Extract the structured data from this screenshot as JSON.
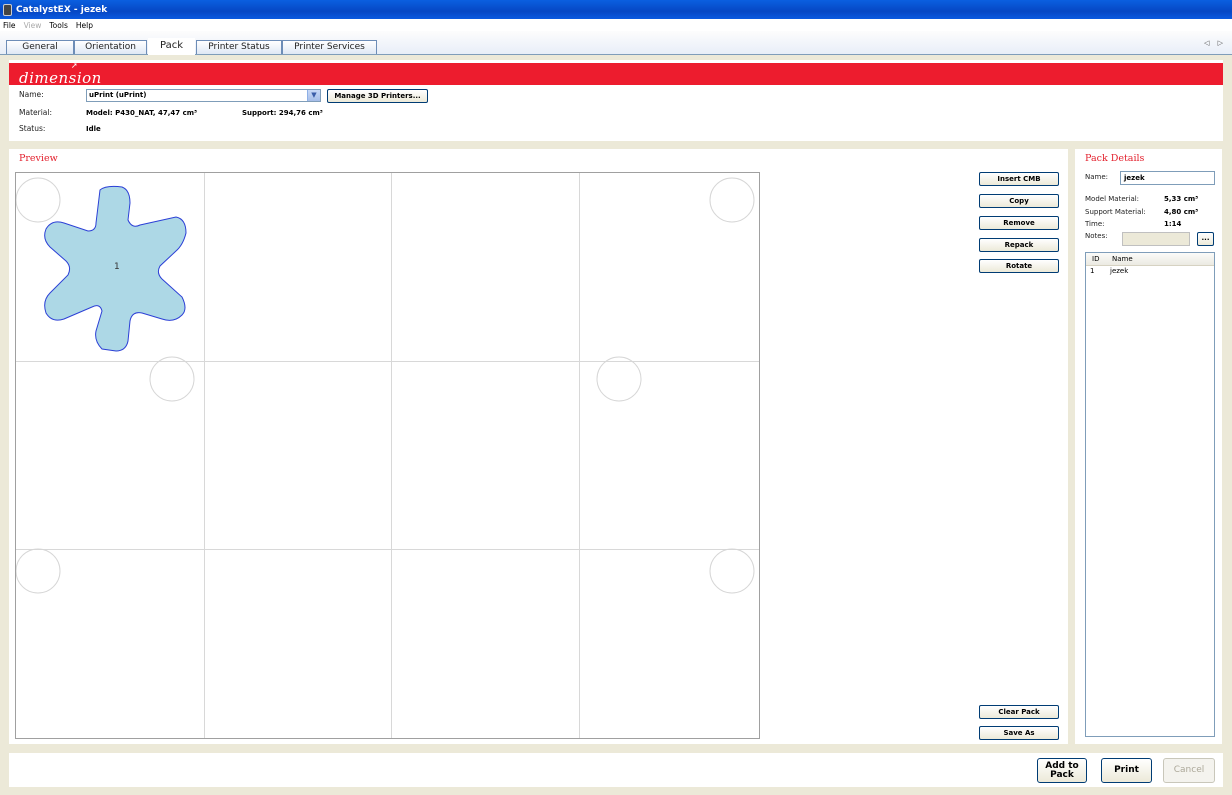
{
  "window": {
    "title": "CatalystEX - jezek"
  },
  "menu": {
    "items": [
      {
        "label": "File",
        "enabled": true
      },
      {
        "label": "View",
        "enabled": false
      },
      {
        "label": "Tools",
        "enabled": true
      },
      {
        "label": "Help",
        "enabled": true
      }
    ]
  },
  "tabs": [
    {
      "label": "General"
    },
    {
      "label": "Orientation"
    },
    {
      "label": "Pack",
      "active": true
    },
    {
      "label": "Printer Status"
    },
    {
      "label": "Printer Services"
    }
  ],
  "tab_scroll": "◁ ▷",
  "brand": {
    "logo_text": "dimension",
    "color": "#ed1c2e"
  },
  "printer": {
    "name_label": "Name:",
    "name_value": "uPrint (uPrint)",
    "manage_button": "Manage 3D Printers...",
    "material_label": "Material:",
    "model_material": "Model: P430_NAT, 47,47 cm³",
    "support_material": "Support: 294,76 cm³",
    "status_label": "Status:",
    "status_value": "Idle"
  },
  "preview": {
    "title": "Preview",
    "part_label": "1",
    "part_color": "#add8e6",
    "buttons": {
      "insert_cmb": "Insert CMB",
      "copy": "Copy",
      "remove": "Remove",
      "repack": "Repack",
      "rotate": "Rotate",
      "clear_pack": "Clear Pack",
      "save_as": "Save As"
    }
  },
  "pack_details": {
    "title": "Pack Details",
    "name_label": "Name:",
    "name_value": "jezek",
    "model_material_label": "Model Material:",
    "model_material_value": "5,33 cm³",
    "support_material_label": "Support Material:",
    "support_material_value": "4,80 cm³",
    "time_label": "Time:",
    "time_value": "1:14",
    "notes_label": "Notes:",
    "notes_button": "...",
    "list": {
      "columns": [
        "ID",
        "Name"
      ],
      "rows": [
        {
          "id": "1",
          "name": "jezek"
        }
      ]
    }
  },
  "bottom": {
    "add_to_pack_line1": "Add to",
    "add_to_pack_line2": "Pack",
    "print": "Print",
    "cancel": "Cancel"
  }
}
